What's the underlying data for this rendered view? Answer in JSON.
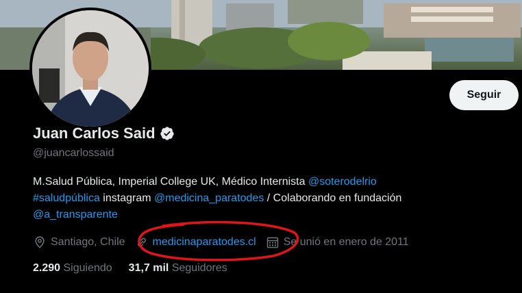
{
  "profile": {
    "name": "Juan Carlos Said",
    "handle": "@juancarlossaid",
    "follow_label": "Seguir"
  },
  "bio": {
    "line1_text": "M.Salud Pública, Imperial College  UK, Médico Internista ",
    "line1_mention": "@soterodelrio",
    "line2_hashtag": "#saludpública",
    "line2_text1": " instagram ",
    "line2_mention": "@medicina_paratodes",
    "line2_text2": " / Colaborando en fundación",
    "line3_mention": "@a_transparente"
  },
  "meta": {
    "location": "Santiago, Chile",
    "url": "medicinaparatodes.cl",
    "joined": "Se unió en enero de 2011"
  },
  "stats": {
    "following_count": "2.290",
    "following_label": "Siguiendo",
    "followers_count": "31,7 mil",
    "followers_label": "Seguidores"
  },
  "colors": {
    "background": "#000000",
    "text": "#e7e9ea",
    "muted": "#71767b",
    "link": "#1d9bf0",
    "annotation": "#e0151a"
  },
  "icons": [
    "verified-badge-icon",
    "location-pin-icon",
    "link-icon",
    "calendar-icon"
  ]
}
